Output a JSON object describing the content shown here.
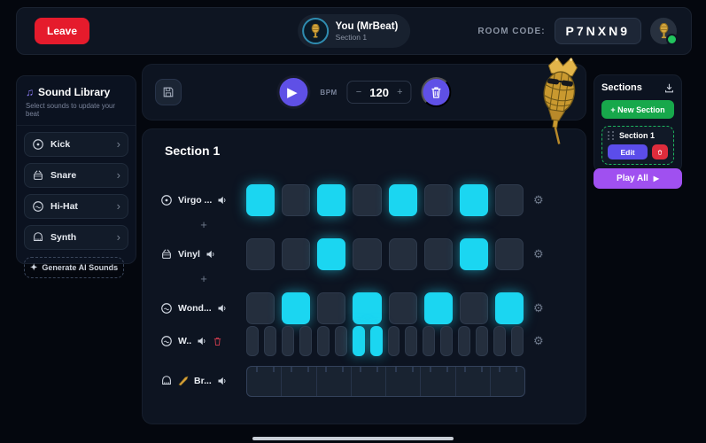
{
  "topbar": {
    "leave_label": "Leave",
    "user": {
      "name": "You (MrBeat)",
      "section": "Section 1"
    },
    "room_code_label": "ROOM CODE:",
    "room_code": "P7NXN9"
  },
  "sound_library": {
    "title": "Sound Library",
    "subtitle": "Select sounds to update your beat",
    "items": [
      {
        "label": "Kick",
        "icon": "kick-icon"
      },
      {
        "label": "Snare",
        "icon": "snare-icon"
      },
      {
        "label": "Hi-Hat",
        "icon": "hihat-icon"
      },
      {
        "label": "Synth",
        "icon": "synth-icon"
      }
    ],
    "generate_label": "Generate AI Sounds"
  },
  "toolbar": {
    "bpm_label": "BPM",
    "bpm_value": "120",
    "minus_label": "−",
    "plus_label": "+",
    "play_icon": "▶"
  },
  "section": {
    "title": "Section 1",
    "plus_label": "+",
    "gear_icon": "⚙",
    "strip_segments": 8,
    "rows": [
      {
        "name": "Virgo ...",
        "icon": "kick-icon",
        "type": "pad8",
        "steps": [
          1,
          0,
          1,
          0,
          1,
          0,
          1,
          0
        ]
      },
      {
        "name": "Vinyl",
        "icon": "snare-icon",
        "type": "pad8",
        "steps": [
          0,
          0,
          1,
          0,
          0,
          0,
          1,
          0
        ]
      },
      {
        "name": "Wond...",
        "icon": "hihat-icon",
        "type": "pad8",
        "steps": [
          0,
          1,
          0,
          1,
          0,
          1,
          0,
          1
        ]
      },
      {
        "name": "W..",
        "icon": "hihat-icon",
        "type": "pad16",
        "steps": [
          0,
          0,
          0,
          0,
          0,
          0,
          1,
          1,
          0,
          0,
          0,
          0,
          0,
          0,
          0,
          0
        ],
        "deletable": true
      },
      {
        "name": "Br...",
        "icon": "synth-icon",
        "type": "strip",
        "emoji": "🎺"
      }
    ]
  },
  "sections_panel": {
    "title": "Sections",
    "new_section_label": "+ New Section",
    "items": [
      {
        "label": "Section 1",
        "edit_label": "Edit"
      }
    ],
    "play_all_label": "Play All",
    "play_all_icon": "▶"
  },
  "colors": {
    "accent_cyan": "#1bd6f1",
    "accent_purple": "#5f50e6",
    "accent_green": "#17a84b",
    "accent_violet": "#a050f0",
    "accent_red": "#e51b2c",
    "panel_bg": "#0d1421",
    "page_bg": "#04070e"
  }
}
